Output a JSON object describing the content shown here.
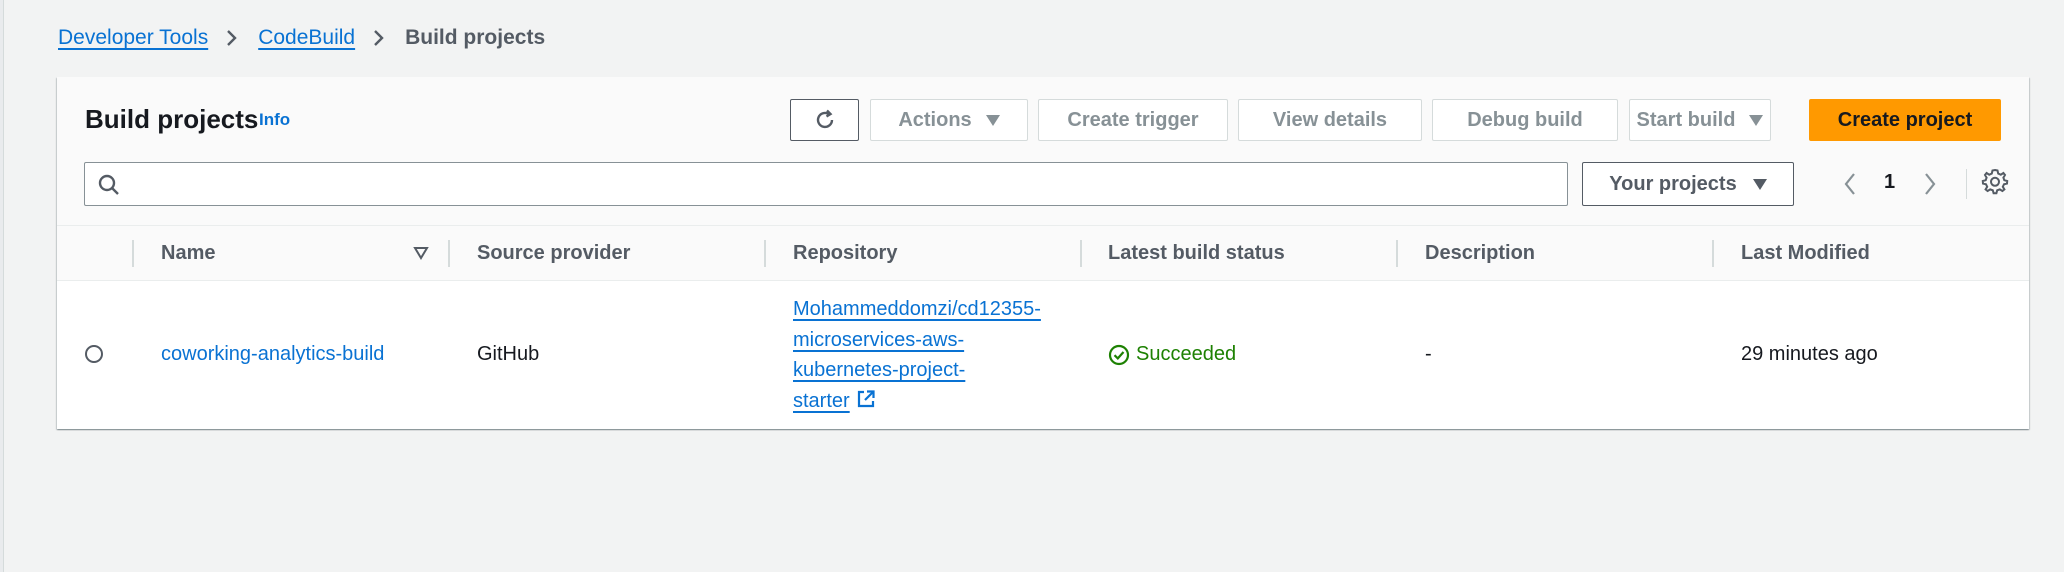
{
  "breadcrumb": {
    "items": [
      "Developer Tools",
      "CodeBuild"
    ],
    "current": "Build projects"
  },
  "header": {
    "title": "Build projects",
    "info": "Info"
  },
  "toolbar": {
    "actions_label": "Actions",
    "create_trigger_label": "Create trigger",
    "view_details_label": "View details",
    "debug_build_label": "Debug build",
    "start_build_label": "Start build",
    "create_project_label": "Create project"
  },
  "filter": {
    "search_value": "",
    "projects_select": "Your projects"
  },
  "pagination": {
    "current_page": "1"
  },
  "table": {
    "columns": [
      "Name",
      "Source provider",
      "Repository",
      "Latest build status",
      "Description",
      "Last Modified"
    ],
    "rows": [
      {
        "name": "coworking-analytics-build",
        "source_provider": "GitHub",
        "repository_lines": [
          "Mohammeddomzi/cd12355-",
          "microservices-aws-",
          "kubernetes-project-",
          "starter"
        ],
        "status": "Succeeded",
        "description": "-",
        "last_modified": "29 minutes ago"
      }
    ]
  },
  "colors": {
    "link": "#0972d3",
    "primary_button": "#ff9900",
    "success": "#1d8102",
    "disabled_text": "#879196"
  },
  "icons": [
    "chevron-right-icon",
    "refresh-icon",
    "caret-down-icon",
    "search-icon",
    "chevron-left-icon",
    "settings-gear-icon",
    "sort-icon",
    "external-link-icon",
    "success-check-icon"
  ]
}
